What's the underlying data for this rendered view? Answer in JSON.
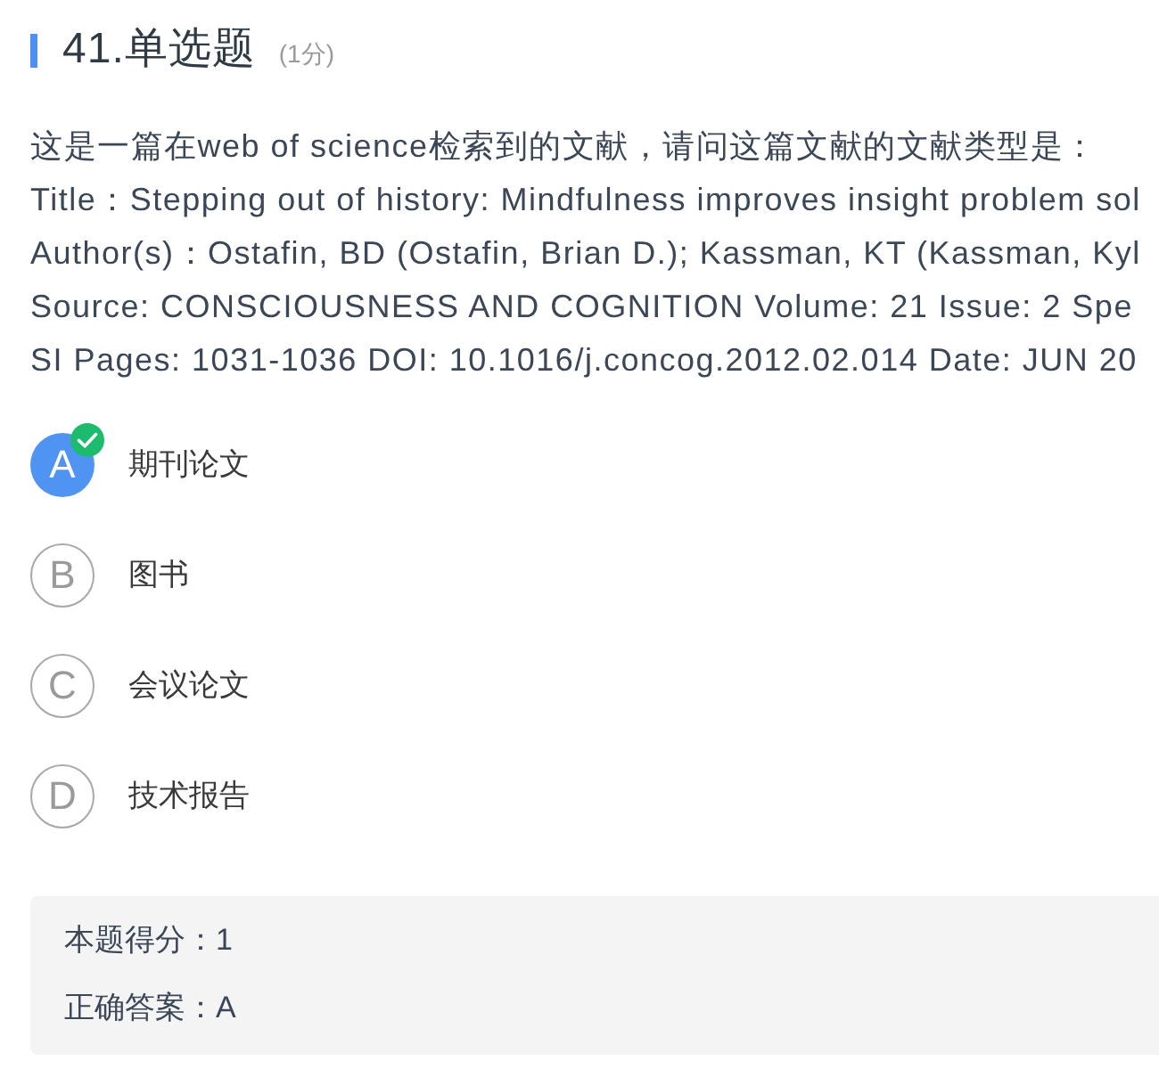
{
  "question": {
    "title": "41.单选题",
    "points": "(1分)",
    "lines": [
      "这是一篇在web of science检索到的文献，请问这篇文献的文献类型是：",
      "Title：Stepping out of history: Mindfulness improves insight problem sol",
      "Author(s)：Ostafin, BD (Ostafin, Brian D.); Kassman, KT (Kassman, Kyl",
      "Source: CONSCIOUSNESS AND COGNITION Volume: 21 Issue: 2 Spe",
      "SI Pages: 1031-1036 DOI: 10.1016/j.concog.2012.02.014 Date: JUN 20"
    ]
  },
  "options": [
    {
      "letter": "A",
      "text": "期刊论文",
      "selected": true
    },
    {
      "letter": "B",
      "text": "图书",
      "selected": false
    },
    {
      "letter": "C",
      "text": "会议论文",
      "selected": false
    },
    {
      "letter": "D",
      "text": "技术报告",
      "selected": false
    }
  ],
  "result": {
    "score": "本题得分：1",
    "answer": "正确答案：A"
  }
}
